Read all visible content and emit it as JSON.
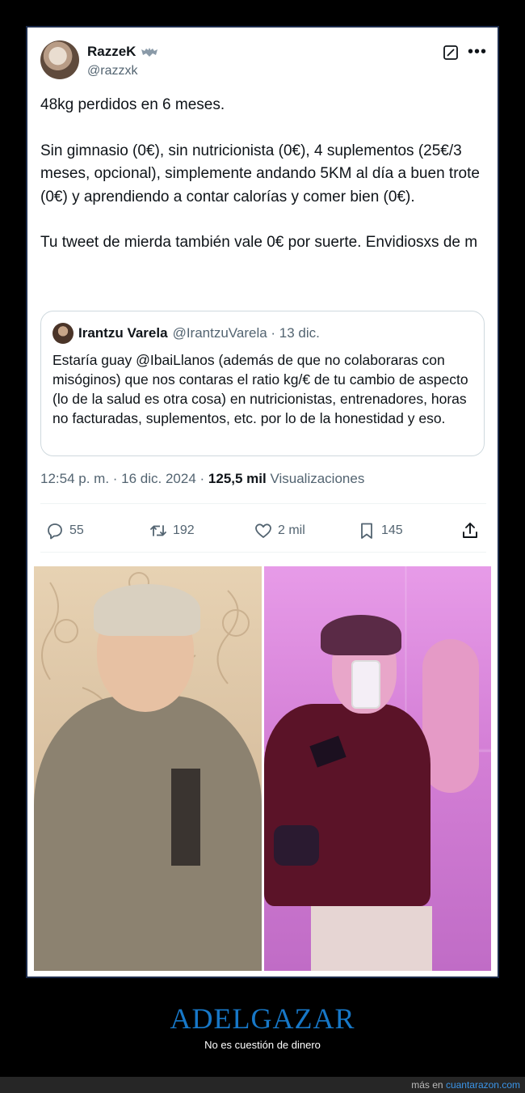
{
  "tweet": {
    "author_name": "RazzeK",
    "author_handle": "@razzxk",
    "paragraphs": [
      "48kg perdidos en 6 meses.",
      "Sin gimnasio (0€), sin nutricionista (0€), 4 suplementos (25€/3 meses, opcional), simplemente andando 5KM al día a buen trote (0€) y aprendiendo a contar calorías y comer bien (0€).",
      "Tu tweet de mierda también vale 0€ por suerte. Envidiosxs de m"
    ],
    "quote": {
      "name": "Irantzu Varela",
      "handle_date": "@IrantzuVarela · 13 dic.",
      "text": "Estaría guay @IbaiLlanos (además de que no colaboraras con misóginos) que nos contaras el ratio kg/€ de tu cambio de aspecto (lo de la salud es otra cosa) en nutricionistas, entrenadores, horas no facturadas, suplementos, etc. por lo de la honestidad y eso."
    },
    "time_date": "12:54 p. m. · 16 dic. 2024 · ",
    "views_count": "125,5 mil",
    "views_label": " Visualizaciones",
    "actions": {
      "replies": "55",
      "retweets": "192",
      "likes": "2 mil",
      "bookmarks": "145"
    }
  },
  "icons": {
    "badge": "bat-icon",
    "edit": "grok-icon",
    "more": "more-icon",
    "reply": "reply-icon",
    "retweet": "retweet-icon",
    "like": "heart-icon",
    "bookmark": "bookmark-icon",
    "share": "share-icon"
  },
  "footer": {
    "title": "ADELGAZAR",
    "subtitle": "No es cuestión de dinero",
    "more_prefix": "más en ",
    "site": "cuantarazon.com"
  },
  "colors": {
    "footer_title": "#1778c8",
    "link": "#3b95e8"
  }
}
